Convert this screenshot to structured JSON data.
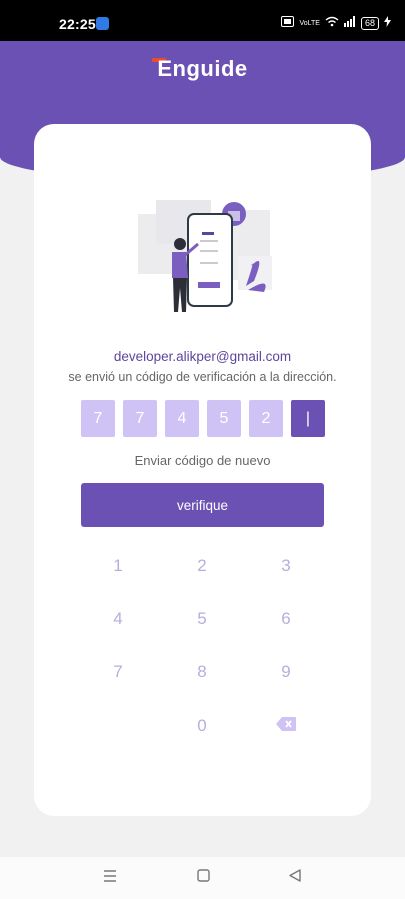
{
  "status_bar": {
    "time": "22:25",
    "battery": "68",
    "net_label": "VoLTE"
  },
  "header": {
    "logo_text": "Enguide"
  },
  "card": {
    "email": "developer.alikper@gmail.com",
    "message": "se envió un código de verificación a la dirección.",
    "code_digits": [
      "7",
      "7",
      "4",
      "5",
      "2",
      "|"
    ],
    "resend_label": "Enviar código de nuevo",
    "verify_label": "verifique"
  },
  "keypad": {
    "keys": [
      "1",
      "2",
      "3",
      "4",
      "5",
      "6",
      "7",
      "8",
      "9",
      "0"
    ],
    "backspace_icon": "backspace-icon"
  },
  "colors": {
    "primary": "#6b51b3",
    "code_inactive": "#cfc3f5",
    "key_text": "#b6aedc",
    "logo_accent": "#e74c2c"
  }
}
